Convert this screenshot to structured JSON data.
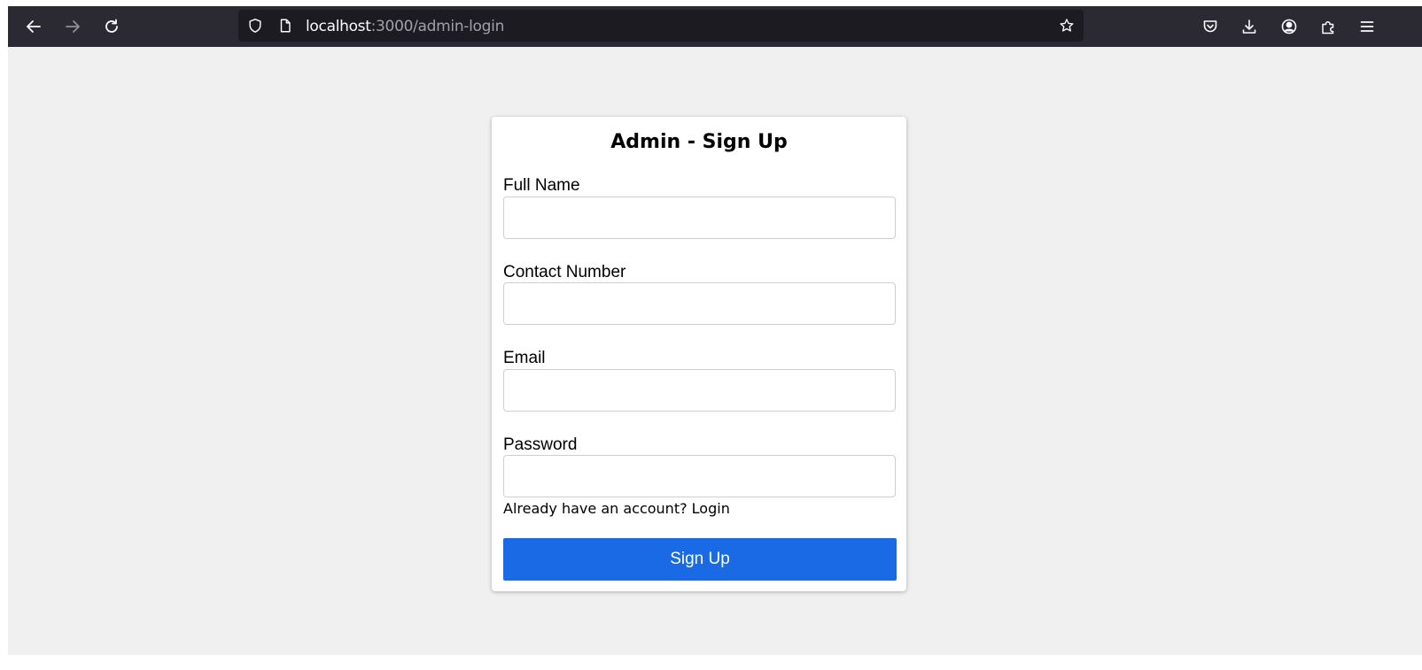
{
  "browser": {
    "url_host": "localhost",
    "url_rest": ":3000/admin-login",
    "icons": {
      "back": "back-arrow-icon",
      "forward": "forward-arrow-icon",
      "reload": "reload-icon",
      "shield": "shield-icon",
      "page": "page-icon",
      "bookmark": "star-icon",
      "pocket": "pocket-icon",
      "download": "download-icon",
      "account": "account-icon",
      "extensions": "extensions-icon",
      "menu": "hamburger-menu-icon"
    }
  },
  "form": {
    "title": "Admin - Sign Up",
    "fields": [
      {
        "label": "Full Name",
        "value": "",
        "placeholder": ""
      },
      {
        "label": "Contact Number",
        "value": "",
        "placeholder": ""
      },
      {
        "label": "Email",
        "value": "",
        "placeholder": ""
      },
      {
        "label": "Password",
        "value": "",
        "placeholder": ""
      }
    ],
    "login_prompt": "Already have an account? ",
    "login_link": "Login",
    "submit_label": "Sign Up"
  },
  "colors": {
    "toolbar_bg": "#2b2a33",
    "urlbar_bg": "#1c1b22",
    "page_bg": "#f0f0f0",
    "button_bg": "#1a6ae5"
  }
}
